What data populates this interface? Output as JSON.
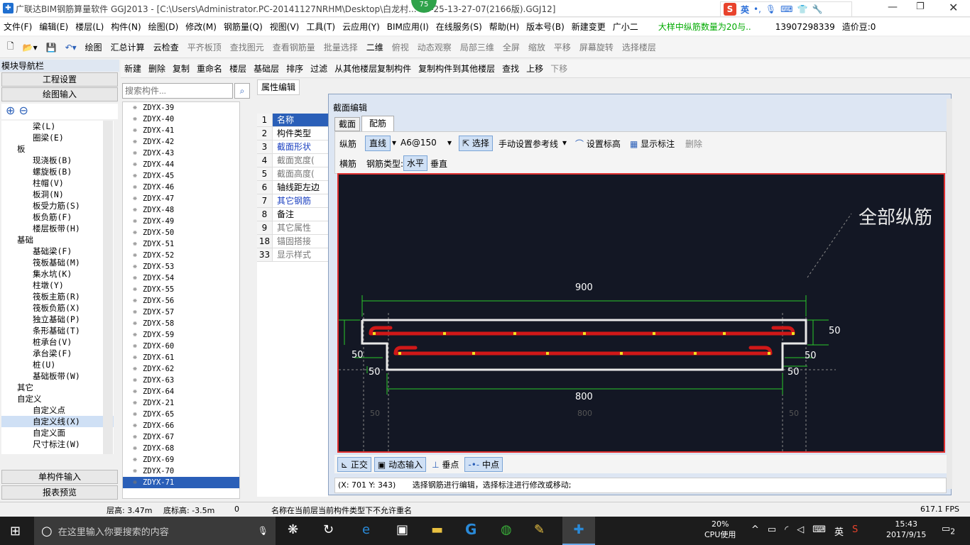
{
  "window": {
    "title": "广联达BIM钢筋算量软件 GGJ2013 - [C:\\Users\\Administrator.PC-20141127NRHM\\Desktop\\白龙村...-08-25-13-27-07(2166版).GGJ12]",
    "badge": "75"
  },
  "menu": [
    "文件(F)",
    "编辑(E)",
    "楼层(L)",
    "构件(N)",
    "绘图(D)",
    "修改(M)",
    "钢筋量(Q)",
    "视图(V)",
    "工具(T)",
    "云应用(Y)",
    "BIM应用(I)",
    "在线服务(S)",
    "帮助(H)",
    "版本号(B)",
    "新建变更",
    "广小二"
  ],
  "menu_notice": "大样中纵筋数量为20与..",
  "menu_phone": "13907298339",
  "menu_price": "造价豆:0",
  "toolbar1": [
    "绘图",
    "汇总计算",
    "云检查",
    "平齐板顶",
    "查找图元",
    "查看钢筋量",
    "批量选择",
    "二维",
    "俯视",
    "动态观察",
    "局部三维",
    "全屏",
    "缩放",
    "平移",
    "屏幕旋转",
    "选择楼层"
  ],
  "toolbar2": [
    "新建",
    "删除",
    "复制",
    "重命名",
    "楼层",
    "基础层",
    "排序",
    "过滤",
    "从其他楼层复制构件",
    "复制构件到其他楼层",
    "查找",
    "上移",
    "下移"
  ],
  "nav": {
    "header": "模块导航栏",
    "btn1": "工程设置",
    "btn2": "绘图输入",
    "btn3": "单构件输入",
    "btn4": "报表预览"
  },
  "tree": [
    {
      "i": 3,
      "t": "梁(L)"
    },
    {
      "i": 3,
      "t": "圈梁(E)"
    },
    {
      "i": 1,
      "t": "板"
    },
    {
      "i": 3,
      "t": "现浇板(B)"
    },
    {
      "i": 3,
      "t": "螺旋板(B)"
    },
    {
      "i": 3,
      "t": "柱帽(V)"
    },
    {
      "i": 3,
      "t": "板洞(N)"
    },
    {
      "i": 3,
      "t": "板受力筋(S)"
    },
    {
      "i": 3,
      "t": "板负筋(F)"
    },
    {
      "i": 3,
      "t": "楼层板带(H)"
    },
    {
      "i": 1,
      "t": "基础"
    },
    {
      "i": 3,
      "t": "基础梁(F)"
    },
    {
      "i": 3,
      "t": "筏板基础(M)"
    },
    {
      "i": 3,
      "t": "集水坑(K)"
    },
    {
      "i": 3,
      "t": "柱墩(Y)"
    },
    {
      "i": 3,
      "t": "筏板主筋(R)"
    },
    {
      "i": 3,
      "t": "筏板负筋(X)"
    },
    {
      "i": 3,
      "t": "独立基础(P)"
    },
    {
      "i": 3,
      "t": "条形基础(T)"
    },
    {
      "i": 3,
      "t": "桩承台(V)"
    },
    {
      "i": 3,
      "t": "承台梁(F)"
    },
    {
      "i": 3,
      "t": "桩(U)"
    },
    {
      "i": 3,
      "t": "基础板带(W)"
    },
    {
      "i": 1,
      "t": "其它"
    },
    {
      "i": 1,
      "t": "自定义"
    },
    {
      "i": 3,
      "t": "自定义点"
    },
    {
      "i": 3,
      "t": "自定义线(X)"
    },
    {
      "i": 3,
      "t": "自定义面"
    },
    {
      "i": 3,
      "t": "尺寸标注(W)"
    }
  ],
  "search_placeholder": "搜索构件...",
  "components": [
    "ZDYX-39",
    "ZDYX-40",
    "ZDYX-41",
    "ZDYX-42",
    "ZDYX-43",
    "ZDYX-44",
    "ZDYX-45",
    "ZDYX-46",
    "ZDYX-47",
    "ZDYX-48",
    "ZDYX-49",
    "ZDYX-50",
    "ZDYX-51",
    "ZDYX-52",
    "ZDYX-53",
    "ZDYX-54",
    "ZDYX-55",
    "ZDYX-56",
    "ZDYX-57",
    "ZDYX-58",
    "ZDYX-59",
    "ZDYX-60",
    "ZDYX-61",
    "ZDYX-62",
    "ZDYX-63",
    "ZDYX-64",
    "ZDYX-21",
    "ZDYX-65",
    "ZDYX-66",
    "ZDYX-67",
    "ZDYX-68",
    "ZDYX-69",
    "ZDYX-70",
    "ZDYX-71"
  ],
  "props_tab": "属性编辑",
  "props": [
    {
      "n": "1",
      "l": "名称"
    },
    {
      "n": "2",
      "l": "构件类型"
    },
    {
      "n": "3",
      "l": "截面形状"
    },
    {
      "n": "4",
      "l": "截面宽度("
    },
    {
      "n": "5",
      "l": "截面高度("
    },
    {
      "n": "6",
      "l": "轴线距左边"
    },
    {
      "n": "7",
      "l": "其它钢筋"
    },
    {
      "n": "8",
      "l": "备注"
    },
    {
      "n": "9",
      "l": "其它属性"
    },
    {
      "n": "18",
      "l": "锚固搭接"
    },
    {
      "n": "33",
      "l": "显示样式"
    }
  ],
  "dialog": {
    "title": "截面编辑",
    "tab1": "截面",
    "tab2": "配筋",
    "r1": [
      "纵筋",
      "直线",
      "A6@150",
      "选择",
      "手动设置参考线",
      "设置标高",
      "显示标注",
      "删除"
    ],
    "r2": [
      "横筋",
      "钢筋类型:",
      "水平",
      "垂直"
    ],
    "canvas_label": "全部纵筋",
    "dims": {
      "top": "900",
      "bottom": "800",
      "left1": "50",
      "left2": "50",
      "right1": "50",
      "right2": "50",
      "right3": "50",
      "right4": "50",
      "ghost1": "50",
      "ghost2": "800",
      "ghost3": "50"
    },
    "bottom": [
      "正交",
      "动态输入",
      "垂点",
      "中点"
    ],
    "coords": "(X: 701 Y: 343)",
    "hint": "选择钢筋进行编辑，选择标注进行修改或移动;"
  },
  "status": {
    "floor_h": "层高: 3.47m",
    "base_h": "底标高: -3.5m",
    "zero": "0",
    "msg": "名称在当前层当前构件类型下不允许重名",
    "fps": "617.1 FPS"
  },
  "taskbar": {
    "search": "在这里输入你要搜索的内容",
    "cpu_pct": "20%",
    "cpu_label": "CPU使用",
    "time": "15:43",
    "date": "2017/9/15",
    "ime": "英",
    "notif": "2"
  },
  "colors": {
    "canvas": "#131724",
    "rebar": "#d01818",
    "accent": "#2a5fb8"
  }
}
